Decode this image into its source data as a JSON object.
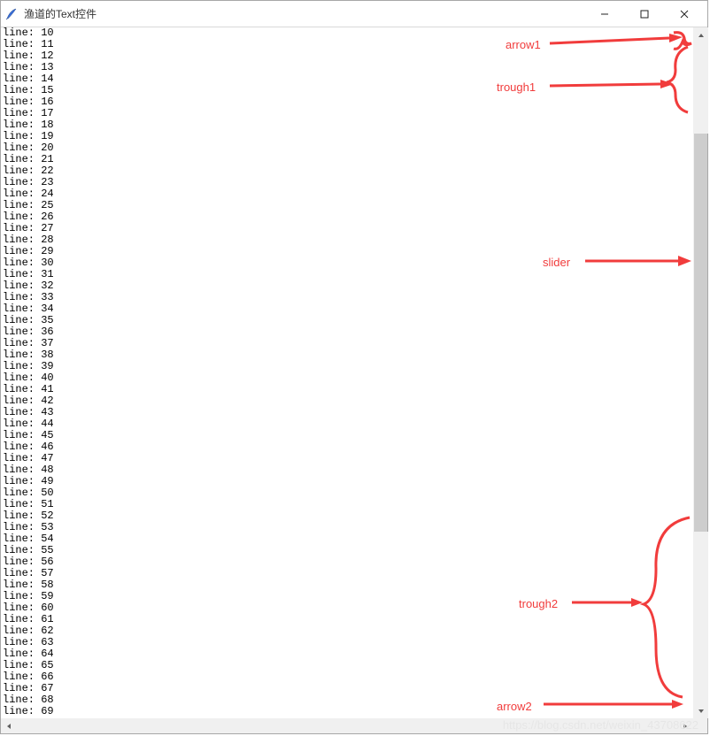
{
  "titlebar": {
    "title": "渔道的Text控件"
  },
  "window_controls": {
    "minimize": "—",
    "maximize": "□",
    "close": "✕"
  },
  "text_lines": [
    "line: 10",
    "line: 11",
    "line: 12",
    "line: 13",
    "line: 14",
    "line: 15",
    "line: 16",
    "line: 17",
    "line: 18",
    "line: 19",
    "line: 20",
    "line: 21",
    "line: 22",
    "line: 23",
    "line: 24",
    "line: 25",
    "line: 26",
    "line: 27",
    "line: 28",
    "line: 29",
    "line: 30",
    "line: 31",
    "line: 32",
    "line: 33",
    "line: 34",
    "line: 35",
    "line: 36",
    "line: 37",
    "line: 38",
    "line: 39",
    "line: 40",
    "line: 41",
    "line: 42",
    "line: 43",
    "line: 44",
    "line: 45",
    "line: 46",
    "line: 47",
    "line: 48",
    "line: 49",
    "line: 50",
    "line: 51",
    "line: 52",
    "line: 53",
    "line: 54",
    "line: 55",
    "line: 56",
    "line: 57",
    "line: 58",
    "line: 59",
    "line: 60",
    "line: 61",
    "line: 62",
    "line: 63",
    "line: 64",
    "line: 65",
    "line: 66",
    "line: 67",
    "line: 68",
    "line: 69"
  ],
  "annotations": {
    "arrow1": "arrow1",
    "trough1": "trough1",
    "slider": "slider",
    "trough2": "trough2",
    "arrow2": "arrow2"
  },
  "watermark": "https://blog.csdn.net/weixin_43708622"
}
